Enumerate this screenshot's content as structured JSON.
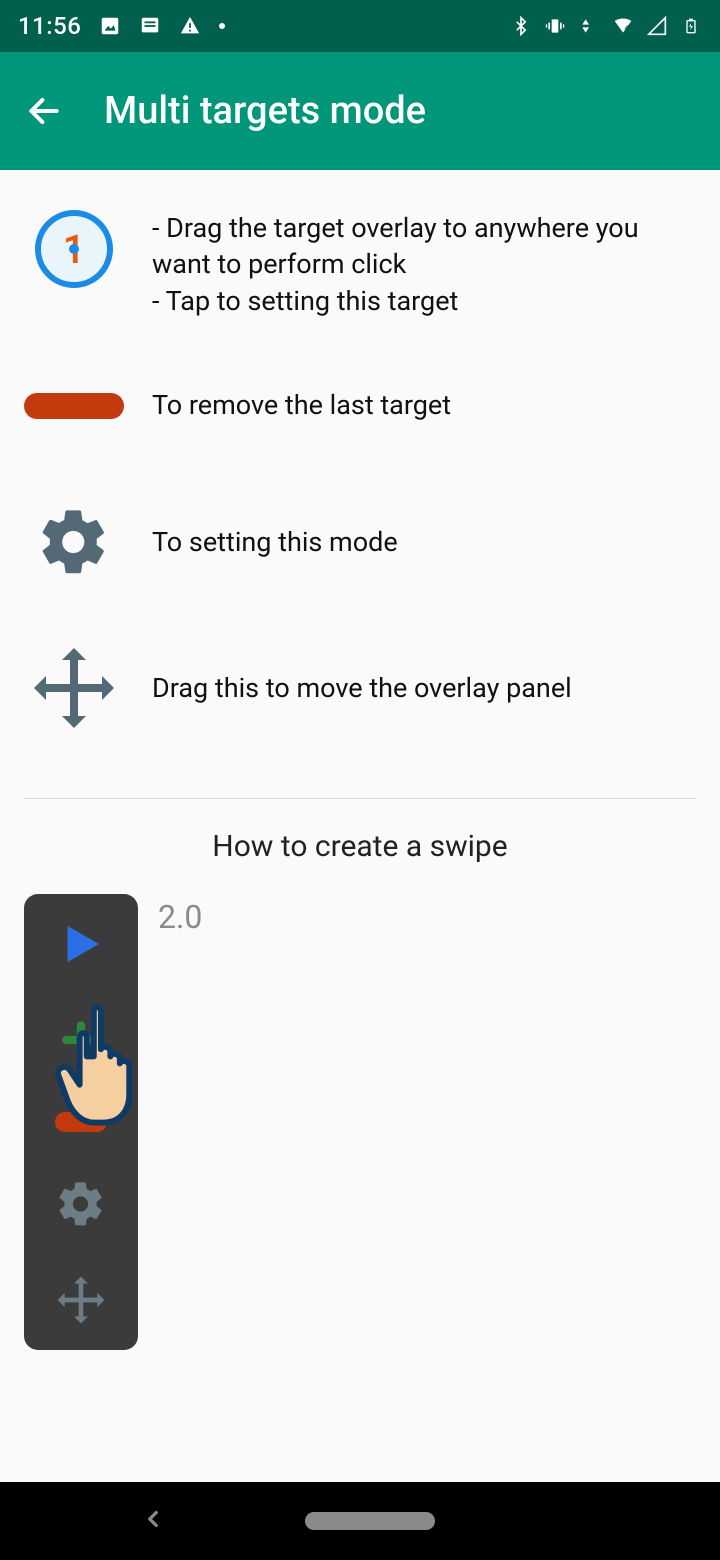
{
  "status": {
    "time": "11:56"
  },
  "appBar": {
    "title": "Multi targets mode"
  },
  "rows": {
    "target": {
      "badge": "1",
      "line1": "- Drag the target overlay to anywhere you want to perform click",
      "line2": "- Tap to setting this target"
    },
    "remove": "To remove the last target",
    "settings": "To setting this mode",
    "move": "Drag this to move the overlay panel"
  },
  "swipe": {
    "title": "How to create a swipe",
    "version": "2.0"
  }
}
